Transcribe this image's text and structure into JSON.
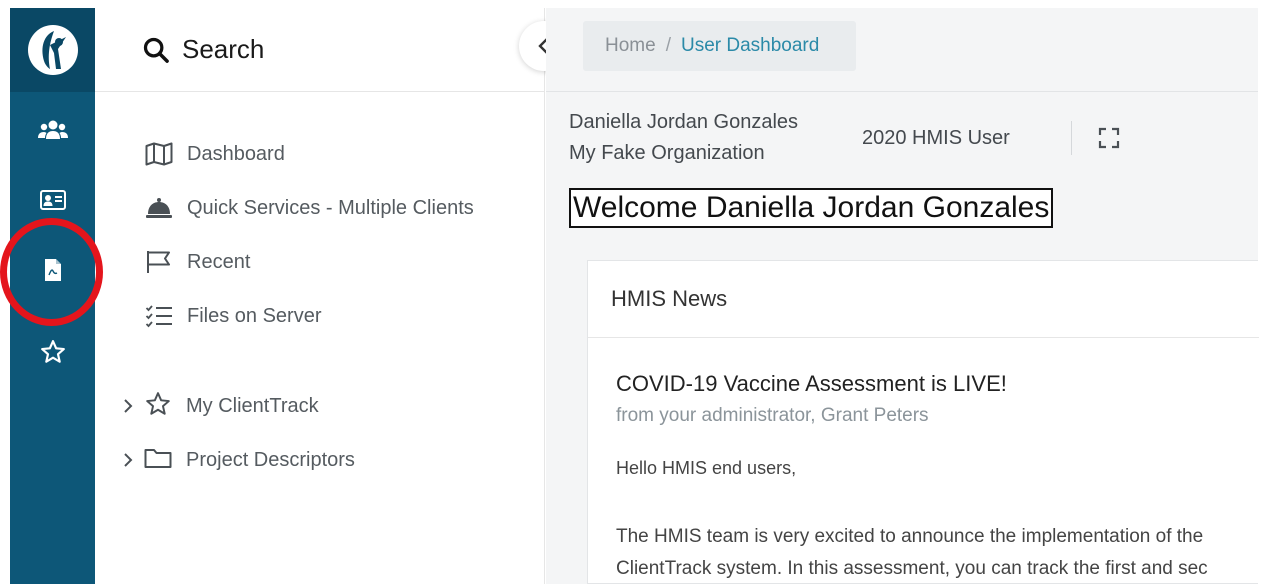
{
  "search": {
    "label": "Search"
  },
  "nav": {
    "items": [
      {
        "label": "Dashboard"
      },
      {
        "label": "Quick Services - Multiple Clients"
      },
      {
        "label": "Recent"
      },
      {
        "label": "Files on Server"
      }
    ],
    "tree": [
      {
        "label": "My ClientTrack"
      },
      {
        "label": "Project Descriptors"
      }
    ]
  },
  "breadcrumb": {
    "home": "Home",
    "separator": "/",
    "current": "User Dashboard"
  },
  "user": {
    "name": "Daniella Jordan Gonzales",
    "organization": "My Fake Organization",
    "role": "2020 HMIS User"
  },
  "welcome": "Welcome Daniella Jordan Gonzales",
  "news": {
    "header": "HMIS News",
    "title": "COVID-19 Vaccine Assessment is LIVE!",
    "from": "from your administrator, Grant Peters",
    "greeting": "Hello HMIS end users,",
    "body_line1": "The HMIS team is very excited to announce the implementation of the",
    "body_line2": "ClientTrack system. In this assessment, you can track the first and sec"
  },
  "colors": {
    "rail": "#0d5778",
    "rail_logo": "#0a4865",
    "accent": "#2b8aa8",
    "annotation": "#e4151c"
  },
  "icons": {
    "rail": [
      "users-icon",
      "id-card-icon",
      "document-icon",
      "star-icon"
    ],
    "nav": [
      "map-icon",
      "service-bell-icon",
      "flag-icon",
      "checklist-icon"
    ],
    "tree": [
      "star-outline-icon",
      "folder-icon"
    ]
  }
}
